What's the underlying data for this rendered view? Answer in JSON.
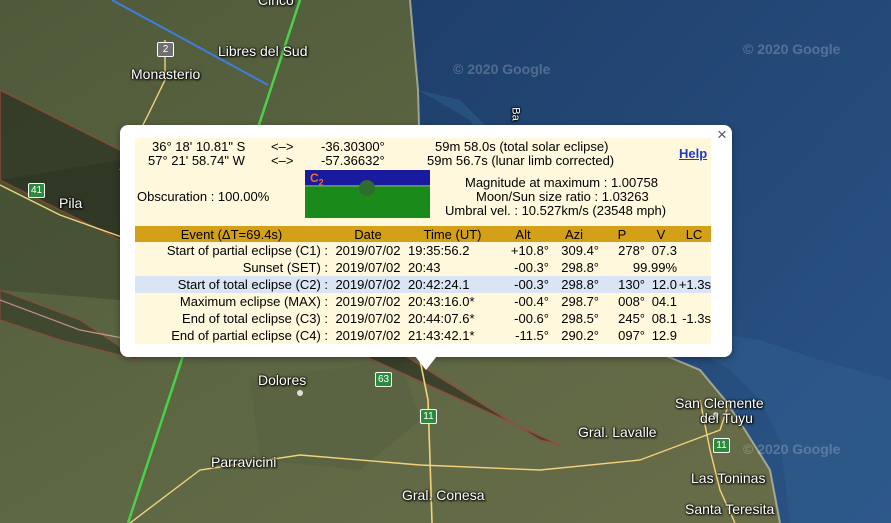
{
  "map": {
    "watermarks": [
      "© 2020 Google",
      "© 2020 Google",
      "© 2020 Google"
    ],
    "labels": {
      "top_town": "Cinco",
      "libres_del_sud": "Libres del Sud",
      "monasterio": "Monasterio",
      "pila": "Pila",
      "dolores": "Dolores",
      "parravicini": "Parravicini",
      "gral_conesa": "Gral. Conesa",
      "gral_lavalle": "Gral. Lavalle",
      "san_clemente": "San Clemente",
      "del_tuyu": "del Tuyu",
      "las_toninas": "Las Toninas",
      "santa_teresita": "Santa Teresita",
      "bay": "Ba"
    },
    "shields": {
      "route2": "2",
      "route41": "41",
      "route63": "63",
      "route11a": "11",
      "route11b": "11"
    }
  },
  "popup": {
    "close_symbol": "×",
    "help_label": "Help",
    "lat_dms": "36° 18' 10.81\" S",
    "lon_dms": "57° 21' 58.74\" W",
    "arrow": "<–>",
    "lat_dec": "-36.30300°",
    "lon_dec": "-57.36632°",
    "duration1": "59m 58.0s (total solar eclipse)",
    "duration2": "59m 56.7s (lunar limb corrected)",
    "obscuration": "Obscuration : 100.00%",
    "magnitude": "Magnitude at maximum : 1.00758",
    "size_ratio": "Moon/Sun size ratio : 1.03263",
    "umbral": "Umbral vel. : 10.527km/s (23548 mph)",
    "thumb_label": "C",
    "thumb_sub": "2",
    "table": {
      "headers": [
        "Event (ΔT=69.4s)",
        "Date",
        "Time (UT)",
        "Alt",
        "Azi",
        "P",
        "V",
        "LC"
      ],
      "rows": [
        [
          "Start of partial eclipse (C1) :",
          "2019/07/02",
          "19:35:56.2",
          "+10.8°",
          "309.4°",
          "278°",
          "07.3",
          ""
        ],
        [
          "Sunset (SET) :",
          "2019/07/02",
          "20:43",
          "-00.3°",
          "298.8°",
          "99.99%",
          "",
          ""
        ],
        [
          "Start of total eclipse (C2) :",
          "2019/07/02",
          "20:42:24.1",
          "-00.3°",
          "298.8°",
          "130°",
          "12.0",
          "+1.3s"
        ],
        [
          "Maximum eclipse (MAX) :",
          "2019/07/02",
          "20:43:16.0*",
          "-00.4°",
          "298.7°",
          "008°",
          "04.1",
          ""
        ],
        [
          "End of total eclipse (C3) :",
          "2019/07/02",
          "20:44:07.6*",
          "-00.6°",
          "298.5°",
          "245°",
          "08.1",
          "-1.3s"
        ],
        [
          "End of partial eclipse (C4) :",
          "2019/07/02",
          "21:43:42.1*",
          "-11.5°",
          "290.2°",
          "097°",
          "12.9",
          ""
        ]
      ]
    }
  },
  "colors": {
    "header_bg": "#d4a017",
    "panel_bg": "#fff8dc",
    "highlight_row": "#d9e4f5",
    "help_link": "#1f3cc4"
  }
}
